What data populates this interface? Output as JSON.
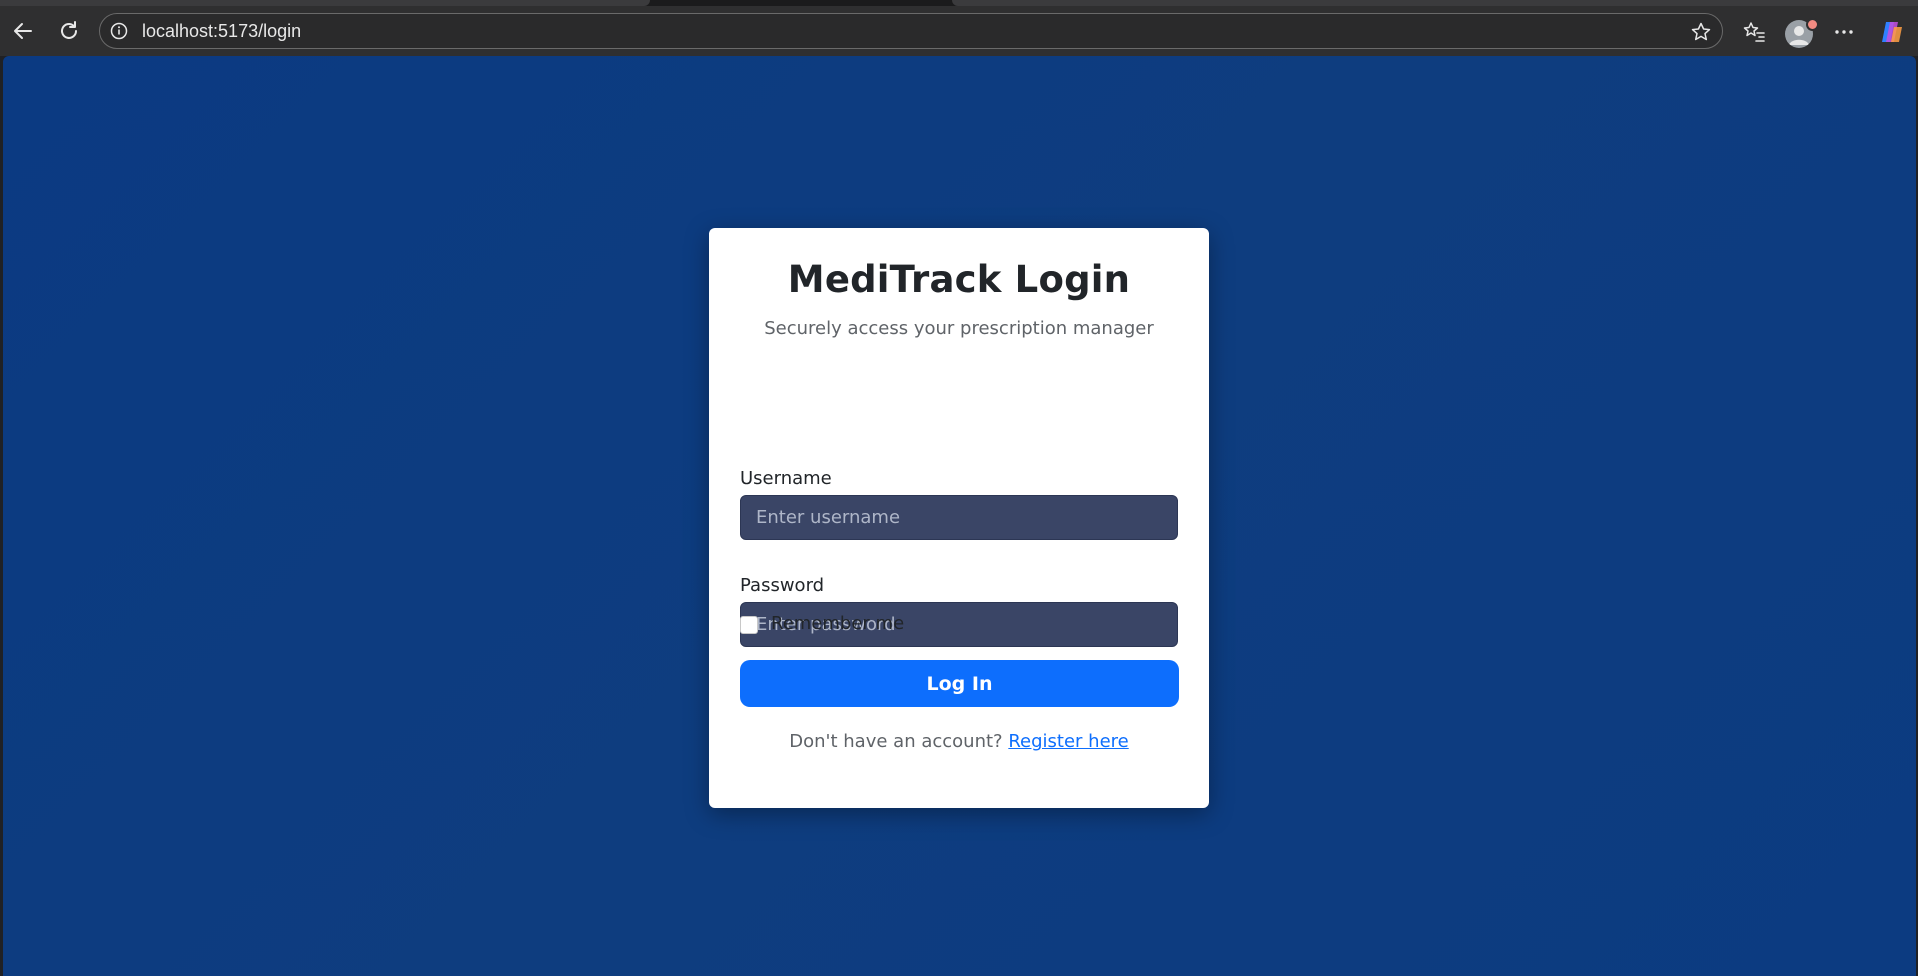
{
  "browser": {
    "url": "localhost:5173/login",
    "icons": {
      "back": "arrow-left-icon",
      "reload": "reload-icon",
      "info": "info-icon",
      "favorite": "star-icon",
      "favorites_list": "favorites-icon",
      "profile": "profile-avatar",
      "menu": "more-icon",
      "copilot": "copilot-icon"
    }
  },
  "login": {
    "title": "MediTrack Login",
    "subtitle": "Securely access your prescription manager",
    "username_label": "Username",
    "username_placeholder": "Enter username",
    "password_label": "Password",
    "password_placeholder": "Enter password",
    "remember_label": "Remember me",
    "submit_label": "Log In",
    "signup_prompt": "Don't have an account?",
    "signup_link": "Register here"
  },
  "colors": {
    "background": "#0c3b81",
    "primary": "#0d6efd",
    "input_bg": "#3a4566"
  }
}
